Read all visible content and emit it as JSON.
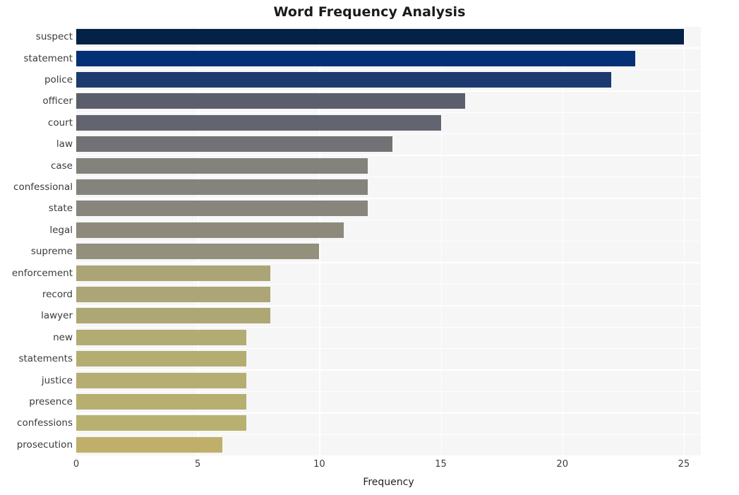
{
  "chart_data": {
    "type": "bar",
    "orientation": "horizontal",
    "title": "Word Frequency Analysis",
    "xlabel": "Frequency",
    "ylabel": "",
    "categories": [
      "suspect",
      "statement",
      "police",
      "officer",
      "court",
      "law",
      "case",
      "confessional",
      "state",
      "legal",
      "supreme",
      "enforcement",
      "record",
      "lawyer",
      "new",
      "statements",
      "justice",
      "presence",
      "confessions",
      "prosecution"
    ],
    "values": [
      25,
      23,
      22,
      16,
      15,
      13,
      12,
      12,
      12,
      11,
      10,
      8,
      8,
      8,
      7,
      7,
      7,
      7,
      7,
      6
    ],
    "bar_colors": [
      "#042146",
      "#043175",
      "#1d3a70",
      "#5b5f6c",
      "#62656f",
      "#727276",
      "#83827b",
      "#85847c",
      "#87857c",
      "#8d8a7c",
      "#93907c",
      "#aaa477",
      "#aca676",
      "#ada774",
      "#b3ac72",
      "#b4ad72",
      "#b6ae71",
      "#b6af70",
      "#b8b06f",
      "#bfaf6b"
    ],
    "xlim": [
      0,
      25.7
    ],
    "xticks": [
      0,
      5,
      10,
      15,
      20,
      25
    ],
    "xtick_labels": [
      "0",
      "5",
      "10",
      "15",
      "20",
      "25"
    ],
    "grid": true,
    "grid_color": "#ffffff",
    "plot_background": "#f6f6f7",
    "figure_background": "#ffffff",
    "legend": null
  }
}
